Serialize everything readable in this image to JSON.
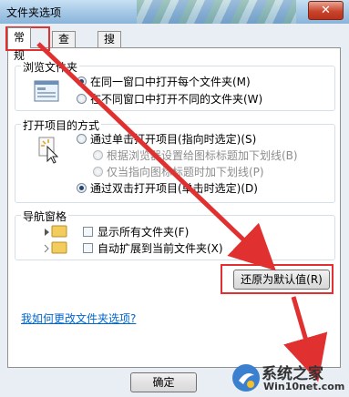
{
  "window": {
    "title": "文件夹选项",
    "close_label": "✕"
  },
  "tabs": [
    {
      "label": "常规",
      "active": true
    },
    {
      "label": "查看"
    },
    {
      "label": "搜索"
    }
  ],
  "browse_folders": {
    "title": "浏览文件夹",
    "options": [
      {
        "label": "在同一窗口中打开每个文件夹(M)",
        "selected": true
      },
      {
        "label": "在不同窗口中打开不同的文件夹(W)",
        "selected": false
      }
    ]
  },
  "open_items": {
    "title": "打开项目的方式",
    "options": [
      {
        "label": "通过单击打开项目(指向时选定)(S)",
        "selected": false
      },
      {
        "label": "根据浏览器设置给图标标题加下划线(B)",
        "selected": false,
        "disabled": true
      },
      {
        "label": "仅当指向图标标题时加下划线(P)",
        "selected": false,
        "disabled": true
      },
      {
        "label": "通过双击打开项目(单击时选定)(D)",
        "selected": true
      }
    ]
  },
  "nav_pane": {
    "title": "导航窗格",
    "checkboxes": [
      {
        "label": "显示所有文件夹(F)",
        "checked": false
      },
      {
        "label": "自动扩展到当前文件夹(X)",
        "checked": false
      }
    ]
  },
  "restore_defaults_label": "还原为默认值(R)",
  "help_link": "我如何更改文件夹选项?",
  "ok_label": "确定",
  "watermark": {
    "brand": "系统之家",
    "url": "Win10net.com"
  },
  "colors": {
    "annotation_red": "#e03030",
    "link": "#0066cc"
  }
}
